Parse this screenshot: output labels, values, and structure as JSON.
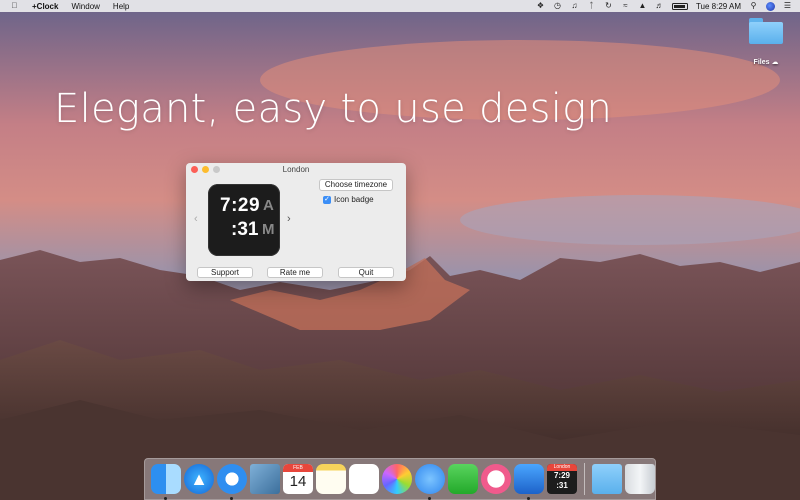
{
  "menubar": {
    "apple_icon": "apple-icon",
    "app_name": "+Clock",
    "menus": [
      "Window",
      "Help"
    ],
    "status_icons": [
      "dropbox-icon",
      "alarm-icon",
      "music-icon",
      "bluetooth-icon",
      "time-machine-icon",
      "wifi-icon",
      "airplay-icon",
      "volume-icon",
      "battery-icon"
    ],
    "clock": "Tue 8:29 AM"
  },
  "desktop": {
    "folder_label": "Files",
    "headline": "Elegant, easy to use design"
  },
  "window": {
    "title": "London",
    "clock": {
      "hours_minutes": "7:29",
      "seconds": ":31",
      "ampm_top": "A",
      "ampm_bottom": "M"
    },
    "choose_timezone_label": "Choose timezone",
    "icon_badge_label": "Icon badge",
    "icon_badge_checked": true,
    "support_label": "Support",
    "rate_label": "Rate me",
    "quit_label": "Quit"
  },
  "dock": {
    "calendar_month": "FEB",
    "calendar_day": "14",
    "clock_city": "London",
    "clock_time_top": "7:29",
    "clock_time_bottom": ":31"
  },
  "colors": {
    "accent": "#3b8ef6",
    "close": "#fc5f57",
    "minimize": "#fdbc2e"
  }
}
